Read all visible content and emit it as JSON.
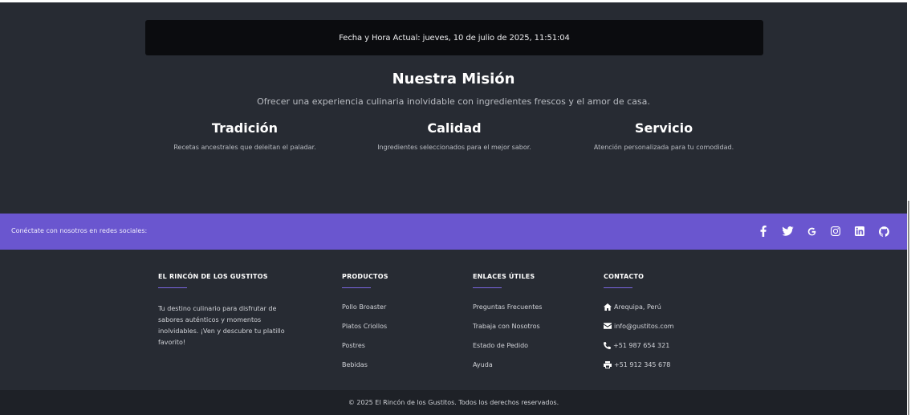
{
  "datetime": {
    "label": "Fecha y Hora Actual:",
    "value": "jueves, 10 de julio de 2025, 11:51:04"
  },
  "mission": {
    "title": "Nuestra Misión",
    "text": "Ofrecer una experiencia culinaria inolvidable con ingredientes frescos y el amor de casa.",
    "pillars": [
      {
        "title": "Tradición",
        "text": "Recetas ancestrales que deleitan el paladar."
      },
      {
        "title": "Calidad",
        "text": "Ingredientes seleccionados para el mejor sabor."
      },
      {
        "title": "Servicio",
        "text": "Atención personalizada para tu comodidad."
      }
    ]
  },
  "social": {
    "text": "Conéctate con nosotros en redes sociales:",
    "icons": [
      "facebook-icon",
      "twitter-icon",
      "google-icon",
      "instagram-icon",
      "linkedin-icon",
      "github-icon"
    ]
  },
  "footer": {
    "about": {
      "title": "EL RINCÓN DE LOS GUSTITOS",
      "text": "Tu destino culinario para disfrutar de sabores auténticos y momentos inolvidables. ¡Ven y descubre tu platillo favorito!"
    },
    "products": {
      "title": "PRODUCTOS",
      "items": [
        "Pollo Broaster",
        "Platos Criollos",
        "Postres",
        "Bebidas"
      ]
    },
    "links": {
      "title": "ENLACES ÚTILES",
      "items": [
        "Preguntas Frecuentes",
        "Trabaja con Nosotros",
        "Estado de Pedido",
        "Ayuda"
      ]
    },
    "contact": {
      "title": "CONTACTO",
      "items": [
        {
          "icon": "home-icon",
          "text": "Arequipa, Perú"
        },
        {
          "icon": "envelope-icon",
          "text": "info@gustitos.com"
        },
        {
          "icon": "phone-icon",
          "text": "+51 987 654 321"
        },
        {
          "icon": "print-icon",
          "text": "+51 912 345 678"
        }
      ]
    }
  },
  "copyright": "© 2025 El Rincón de los Gustitos. Todos los derechos reservados.",
  "colors": {
    "background": "#272b33",
    "social_bar": "#6a56cf",
    "accent_line": "#7a66e0",
    "datetime_box": "#0b0c0f",
    "copyright_bar": "#1e2127"
  }
}
